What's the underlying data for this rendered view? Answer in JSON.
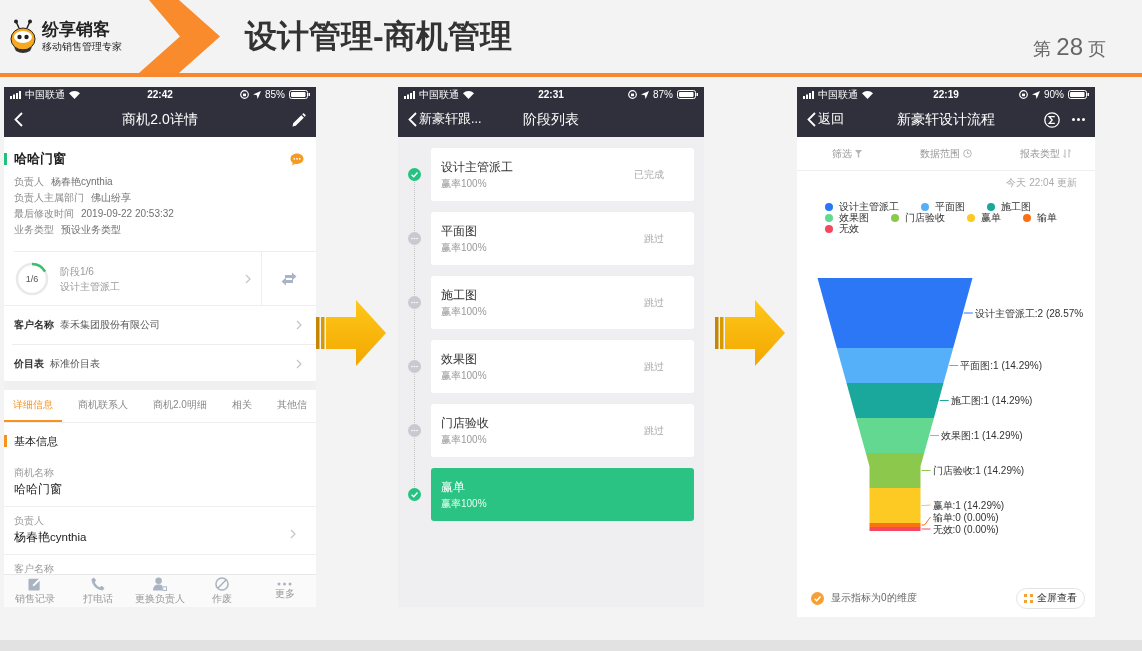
{
  "header": {
    "logo_name": "纷享销客",
    "logo_tagline": "移动销售管理专家",
    "title": "设计管理-商机管理",
    "page": {
      "prefix": "第",
      "number": "28",
      "suffix": "页"
    }
  },
  "detail_screen": {
    "status_bar": {
      "carrier": "中国联通",
      "time": "22:42",
      "battery": "85%"
    },
    "nav": {
      "title": "商机2.0详情"
    },
    "summary": {
      "name": "哈哈门窗",
      "fields": [
        {
          "label": "负责人",
          "value": "杨春艳cynthia"
        },
        {
          "label": "负责人主属部门",
          "value": "佛山纷享"
        },
        {
          "label": "最后修改时间",
          "value": "2019-09-22 20:53:32"
        },
        {
          "label": "业务类型",
          "value": "预设业务类型"
        }
      ]
    },
    "stage": {
      "ring_text": "1/6",
      "level": 0.1667,
      "title": "阶段1/6",
      "name": "设计主管派工"
    },
    "links": [
      {
        "label": "客户名称",
        "value": "泰禾集团股份有限公司"
      },
      {
        "label": "价目表",
        "value": "标准价目表"
      }
    ],
    "tabs": [
      {
        "label": "详细信息",
        "selected": true
      },
      {
        "label": "商机联系人",
        "selected": false
      },
      {
        "label": "商机2.0明细",
        "selected": false
      },
      {
        "label": "相关",
        "selected": false
      },
      {
        "label": "其他信",
        "selected": false
      }
    ],
    "section_title": "基本信息",
    "detail_fields": [
      {
        "label": "商机名称",
        "value": "哈哈门窗",
        "has_arrow": false
      },
      {
        "label": "负责人",
        "value": "杨春艳cynthia",
        "has_arrow": true
      },
      {
        "label": "客户名称",
        "has_arrow": false
      }
    ],
    "toolbar": [
      {
        "label": "销售记录",
        "kind": "edit"
      },
      {
        "label": "打电话",
        "kind": "phone"
      },
      {
        "label": "更换负责人",
        "kind": "person"
      },
      {
        "label": "作废",
        "kind": "void"
      },
      {
        "label": "更多",
        "kind": "more"
      }
    ]
  },
  "stage_screen": {
    "status_bar": {
      "carrier": "中国联通",
      "time": "22:31",
      "battery": "87%"
    },
    "nav": {
      "back": "新豪轩跟...",
      "title": "阶段列表"
    },
    "stages": [
      {
        "name": "设计主管派工",
        "rate": "赢率100%",
        "status": "已完成",
        "done": true,
        "selected": false
      },
      {
        "name": "平面图",
        "rate": "赢率100%",
        "status": "跳过",
        "done": false,
        "selected": false
      },
      {
        "name": "施工图",
        "rate": "赢率100%",
        "status": "跳过",
        "done": false,
        "selected": false
      },
      {
        "name": "效果图",
        "rate": "赢率100%",
        "status": "跳过",
        "done": false,
        "selected": false
      },
      {
        "name": "门店验收",
        "rate": "赢率100%",
        "status": "跳过",
        "done": false,
        "selected": false
      },
      {
        "name": "赢单",
        "rate": "赢率100%",
        "done": true,
        "selected": true
      }
    ]
  },
  "report_screen": {
    "status_bar": {
      "carrier": "中国联通",
      "time": "22:19",
      "battery": "90%"
    },
    "nav": {
      "back": "返回",
      "title": "新豪轩设计流程"
    },
    "filters": [
      {
        "label": "筛选",
        "kind": "filter"
      },
      {
        "label": "数据范围",
        "kind": "range"
      },
      {
        "label": "报表类型",
        "kind": "type"
      }
    ],
    "updated": "今天 22:04 更新",
    "legend": [
      {
        "label": "设计主管派工",
        "color": "#2b77f5"
      },
      {
        "label": "平面图",
        "color": "#55b0f9"
      },
      {
        "label": "施工图",
        "color": "#19a89b"
      },
      {
        "label": "效果图",
        "color": "#62d890"
      },
      {
        "label": "门店验收",
        "color": "#8bc84b"
      },
      {
        "label": "赢单",
        "color": "#fdca24"
      },
      {
        "label": "输单",
        "color": "#fa7115"
      },
      {
        "label": "无效",
        "color": "#f5485e"
      }
    ],
    "funnel_labels": [
      "设计主管派工:2 (28.57%",
      "平面图:1 (14.29%)",
      "施工图:1 (14.29%)",
      "效果图:1 (14.29%)",
      "门店验收:1 (14.29%)",
      "赢单:1 (14.29%)",
      "输单:0 (0.00%)",
      "无效:0 (0.00%)"
    ],
    "show_zero": {
      "label": "显示指标为0的维度",
      "checked": true
    },
    "fullscreen_button": "全屏查看"
  }
}
